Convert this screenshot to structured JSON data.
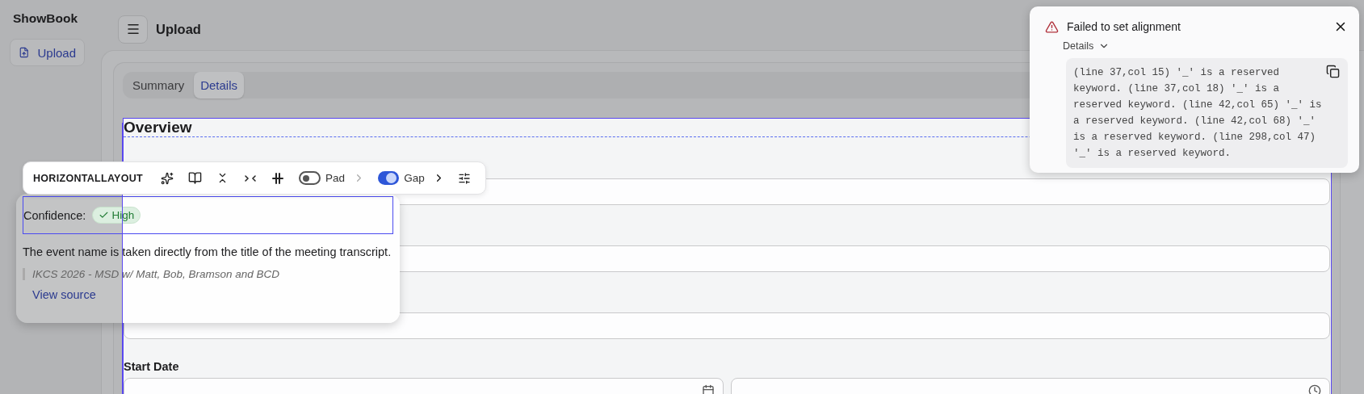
{
  "app": {
    "name": "ShowBook"
  },
  "sidebar": {
    "items": [
      {
        "label": "Upload",
        "selected": true
      }
    ]
  },
  "header": {
    "title": "Upload"
  },
  "tabs": [
    {
      "label": "Summary",
      "selected": false
    },
    {
      "label": "Details",
      "selected": true
    }
  ],
  "section": {
    "title": "Overview",
    "fields": [
      {
        "kind": "text"
      },
      {
        "kind": "text"
      },
      {
        "kind": "text"
      }
    ],
    "start_date": {
      "label": "Start Date",
      "inputs": [
        {
          "kind": "date"
        },
        {
          "kind": "time"
        }
      ]
    }
  },
  "layout_toolbar": {
    "title": "HORIZONTALLAYOUT",
    "toggles": [
      {
        "label": "Pad",
        "on": false
      },
      {
        "label": "Gap",
        "on": true
      }
    ]
  },
  "popover": {
    "confidence_label": "Confidence:",
    "confidence": "High",
    "explanation": "The event name is taken directly from the title of the meeting transcript.",
    "quote": "IKCS 2026 - MSD w/ Matt, Bob, Bramson and BCD",
    "link": "View source"
  },
  "toast": {
    "title": "Failed to set alignment",
    "details_label": "Details",
    "expanded": true,
    "message": "(line 37,col 15) '_' is a reserved keyword. (line 37,col 18) '_' is a reserved keyword. (line 42,col 65) '_' is a reserved keyword. (line 42,col 68) '_' is a reserved keyword. (line 298,col 47) '_' is a reserved keyword."
  }
}
